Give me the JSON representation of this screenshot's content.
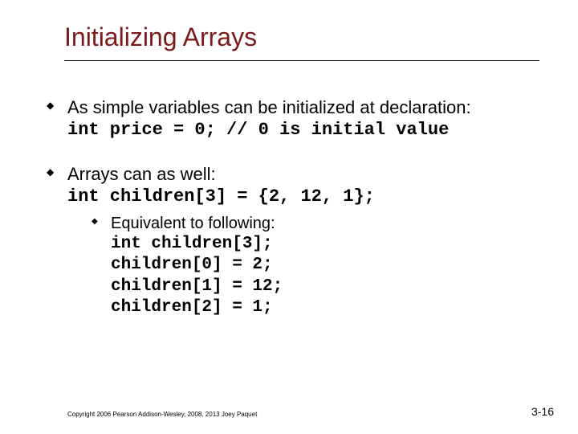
{
  "title": "Initializing Arrays",
  "bullets": {
    "b1": {
      "text": "As simple variables can be initialized at declaration:",
      "code": "int price = 0;  // 0 is initial value"
    },
    "b2": {
      "text": "Arrays can as well:",
      "code": "int children[3] = {2, 12, 1};",
      "sub": {
        "text": "Equivalent to following:",
        "code1": "int children[3];",
        "code2": "children[0] = 2;",
        "code3": "children[1] = 12;",
        "code4": "children[2] = 1;"
      }
    }
  },
  "footer": {
    "copyright": "Copyright 2006 Pearson Addison-Wesley, 2008, 2013 Joey Paquet",
    "page": "3-16"
  }
}
